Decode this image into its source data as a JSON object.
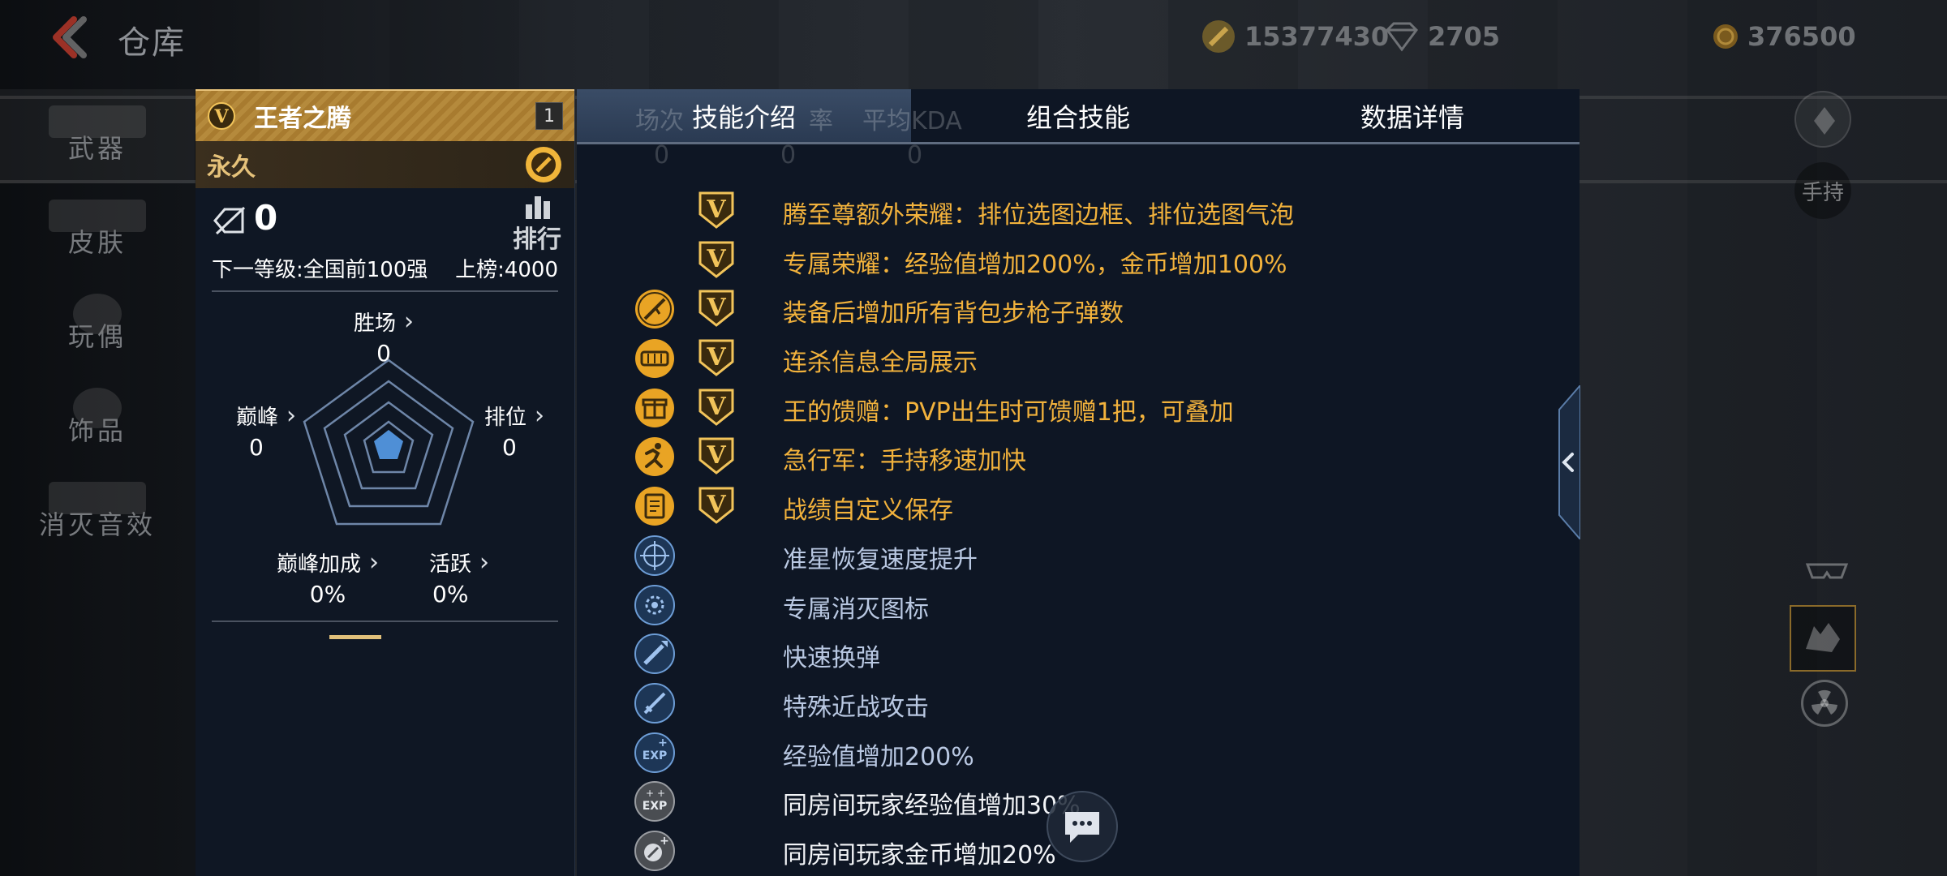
{
  "header": {
    "title": "仓库",
    "currencies": [
      {
        "icon": "gold-bullet-icon",
        "value": "15377430"
      },
      {
        "icon": "diamond-icon",
        "value": "2705"
      },
      {
        "icon": "coin-icon",
        "value": "376500"
      }
    ]
  },
  "sidebar": {
    "items": [
      {
        "label": "武器"
      },
      {
        "label": "皮肤"
      },
      {
        "label": "玩偶"
      },
      {
        "label": "饰品"
      },
      {
        "label": "消灭音效"
      }
    ]
  },
  "item": {
    "name": "王者之腾",
    "level": "1",
    "duration": "永久",
    "rank": "0",
    "rank_label": "排行",
    "next_level": "下一等级:全国前100强",
    "board": "上榜:4000",
    "stats": {
      "wins": {
        "label": "胜场",
        "value": "0"
      },
      "peak": {
        "label": "巅峰",
        "value": "0"
      },
      "ranked": {
        "label": "排位",
        "value": "0"
      },
      "peak_bonus": {
        "label": "巅峰加成",
        "value": "0%"
      },
      "active": {
        "label": "活跃",
        "value": "0%"
      }
    }
  },
  "tabs": [
    {
      "label": "技能介绍"
    },
    {
      "label": "组合技能"
    },
    {
      "label": "数据详情"
    }
  ],
  "tab_underlay": {
    "col1": "场次",
    "col2": "率",
    "col3": "平均KDA",
    "zero1": "0",
    "zero2": "0",
    "zero3": "0"
  },
  "skills": [
    {
      "text": "腾至尊额外荣耀：排位选图边框、排位选图气泡",
      "style": "gold",
      "icon": "none",
      "badge": true
    },
    {
      "text": "专属荣耀：经验值增加200%，金币增加100%",
      "style": "gold",
      "icon": "none",
      "badge": true
    },
    {
      "text": "装备后增加所有背包步枪子弹数",
      "style": "gold",
      "icon": "rifle-ammo-icon",
      "badge": true
    },
    {
      "text": "连杀信息全局展示",
      "style": "gold",
      "icon": "killstreak-broadcast-icon",
      "badge": true
    },
    {
      "text": "王的馈赠：PVP出生时可馈赠1把，可叠加",
      "style": "gold",
      "icon": "gift-icon",
      "badge": true
    },
    {
      "text": "急行军：手持移速加快",
      "style": "gold",
      "icon": "running-man-icon",
      "badge": true
    },
    {
      "text": "战绩自定义保存",
      "style": "gold",
      "icon": "record-save-icon",
      "badge": true
    },
    {
      "text": "准星恢复速度提升",
      "style": "blue",
      "icon": "crosshair-icon",
      "badge": false
    },
    {
      "text": "专属消灭图标",
      "style": "blue",
      "icon": "kill-icon",
      "badge": false
    },
    {
      "text": "快速换弹",
      "style": "blue",
      "icon": "fast-reload-icon",
      "badge": false
    },
    {
      "text": "特殊近战攻击",
      "style": "blue",
      "icon": "melee-attack-icon",
      "badge": false
    },
    {
      "text": "经验值增加200%",
      "style": "blue",
      "icon": "exp-boost-icon",
      "badge": false
    },
    {
      "text": "同房间玩家经验值增加30%",
      "style": "white",
      "icon": "room-exp-icon",
      "badge": false
    },
    {
      "text": "同房间玩家金币增加20%",
      "style": "white",
      "icon": "room-coin-icon",
      "badge": false
    }
  ],
  "right_side": {
    "hold_label": "手持"
  },
  "colors": {
    "gold": "#f2b23c",
    "blue": "#b9c8e2",
    "accent": "#e0c07a"
  }
}
